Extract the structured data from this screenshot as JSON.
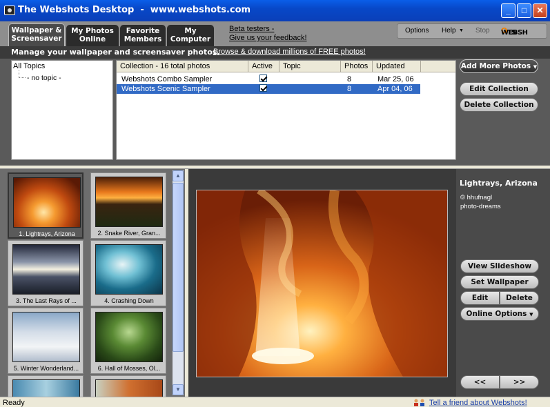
{
  "window": {
    "title": "The Webshots Desktop  -  www.webshots.com",
    "min": "_",
    "max": "□",
    "close": "✕"
  },
  "tabs": [
    {
      "label1": "Wallpaper &",
      "label2": "Screensaver"
    },
    {
      "label1": "My Photos",
      "label2": "Online"
    },
    {
      "label1": "Favorite",
      "label2": "Members"
    },
    {
      "label1": "My",
      "label2": "Computer"
    }
  ],
  "beta": {
    "line1": "Beta testers -",
    "line2": "Give us your feedback!"
  },
  "menu": {
    "options": "Options",
    "help": "Help",
    "stop": "Stop",
    "logo_a": "WEBSH",
    "logo_b": "O",
    "logo_c": "TS"
  },
  "subbar": {
    "manage": "Manage your wallpaper and screensaver photos.",
    "browse": "Browse & download millions of FREE photos!"
  },
  "tree": {
    "all": "All Topics",
    "none": "- no topic -"
  },
  "grid": {
    "headers": {
      "collection": "Collection - 16 total photos",
      "active": "Active",
      "topic": "Topic",
      "photos": "Photos",
      "updated": "Updated"
    },
    "rows": [
      {
        "name": "Webshots Combo Sampler",
        "photos": "8",
        "updated": "Mar 25, 06"
      },
      {
        "name": "Webshots Scenic Sampler",
        "photos": "8",
        "updated": "Apr 04, 06"
      }
    ]
  },
  "collection_buttons": {
    "add": "Add More Photos",
    "edit": "Edit Collection",
    "delete": "Delete Collection"
  },
  "thumbs": [
    {
      "caption": "1. Lightrays, Arizona"
    },
    {
      "caption": "2. Snake River, Gran..."
    },
    {
      "caption": "3. The Last Rays of ..."
    },
    {
      "caption": "4. Crashing Down"
    },
    {
      "caption": "5. Winter Wonderland..."
    },
    {
      "caption": "6. Hall of Mosses, Ol..."
    },
    {
      "caption": ""
    },
    {
      "caption": ""
    }
  ],
  "photo": {
    "title": "Lightrays, Arizona",
    "credit1": "© hhufnagl",
    "credit2": "photo-dreams"
  },
  "actions": {
    "slideshow": "View Slideshow",
    "wallpaper": "Set Wallpaper",
    "edit": "Edit",
    "delete": "Delete",
    "online": "Online Options",
    "prev": "<<",
    "next": ">>"
  },
  "status": {
    "ready": "Ready",
    "tell": "Tell a friend about Webshots!"
  }
}
